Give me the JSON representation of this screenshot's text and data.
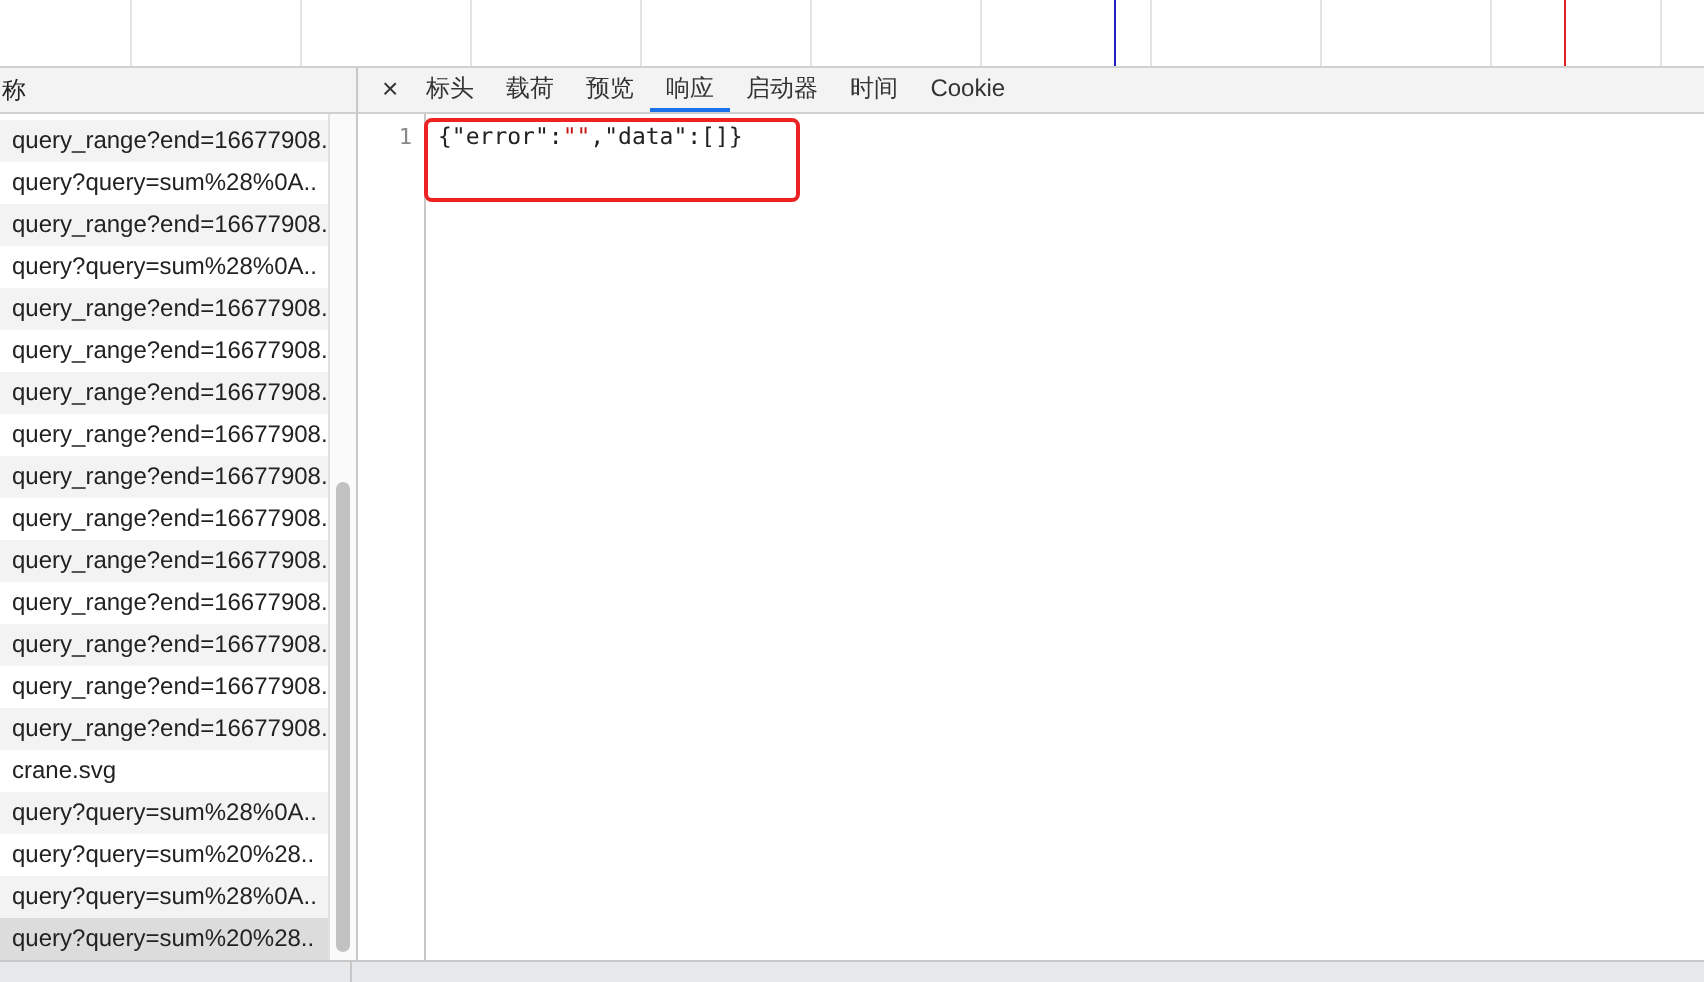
{
  "list_header": "称",
  "requests": [
    {
      "name": "query_range?end=16677908.",
      "selected": false
    },
    {
      "name": "query?query=sum%28%0A..",
      "selected": false
    },
    {
      "name": "query_range?end=16677908.",
      "selected": false
    },
    {
      "name": "query?query=sum%28%0A..",
      "selected": false
    },
    {
      "name": "query_range?end=16677908.",
      "selected": false
    },
    {
      "name": "query_range?end=16677908.",
      "selected": false
    },
    {
      "name": "query_range?end=16677908.",
      "selected": false
    },
    {
      "name": "query_range?end=16677908.",
      "selected": false
    },
    {
      "name": "query_range?end=16677908.",
      "selected": false
    },
    {
      "name": "query_range?end=16677908.",
      "selected": false
    },
    {
      "name": "query_range?end=16677908.",
      "selected": false
    },
    {
      "name": "query_range?end=16677908.",
      "selected": false
    },
    {
      "name": "query_range?end=16677908.",
      "selected": false
    },
    {
      "name": "query_range?end=16677908.",
      "selected": false
    },
    {
      "name": "query_range?end=16677908.",
      "selected": false
    },
    {
      "name": "crane.svg",
      "selected": false
    },
    {
      "name": "query?query=sum%28%0A..",
      "selected": false
    },
    {
      "name": "query?query=sum%20%28..",
      "selected": false
    },
    {
      "name": "query?query=sum%28%0A..",
      "selected": false
    },
    {
      "name": "query?query=sum%20%28..",
      "selected": true
    }
  ],
  "close_button": "×",
  "tabs": [
    {
      "label": "标头",
      "selected": false
    },
    {
      "label": "载荷",
      "selected": false
    },
    {
      "label": "预览",
      "selected": false
    },
    {
      "label": "响应",
      "selected": true
    },
    {
      "label": "启动器",
      "selected": false
    },
    {
      "label": "时间",
      "selected": false
    },
    {
      "label": "Cookie",
      "selected": false
    }
  ],
  "response": {
    "lines": [
      {
        "number": "1",
        "tokens": [
          {
            "text": "{\"error\":",
            "kind": "plain"
          },
          {
            "text": "\"\"",
            "kind": "string"
          },
          {
            "text": ",\"data\":[]}",
            "kind": "plain"
          }
        ]
      }
    ]
  }
}
